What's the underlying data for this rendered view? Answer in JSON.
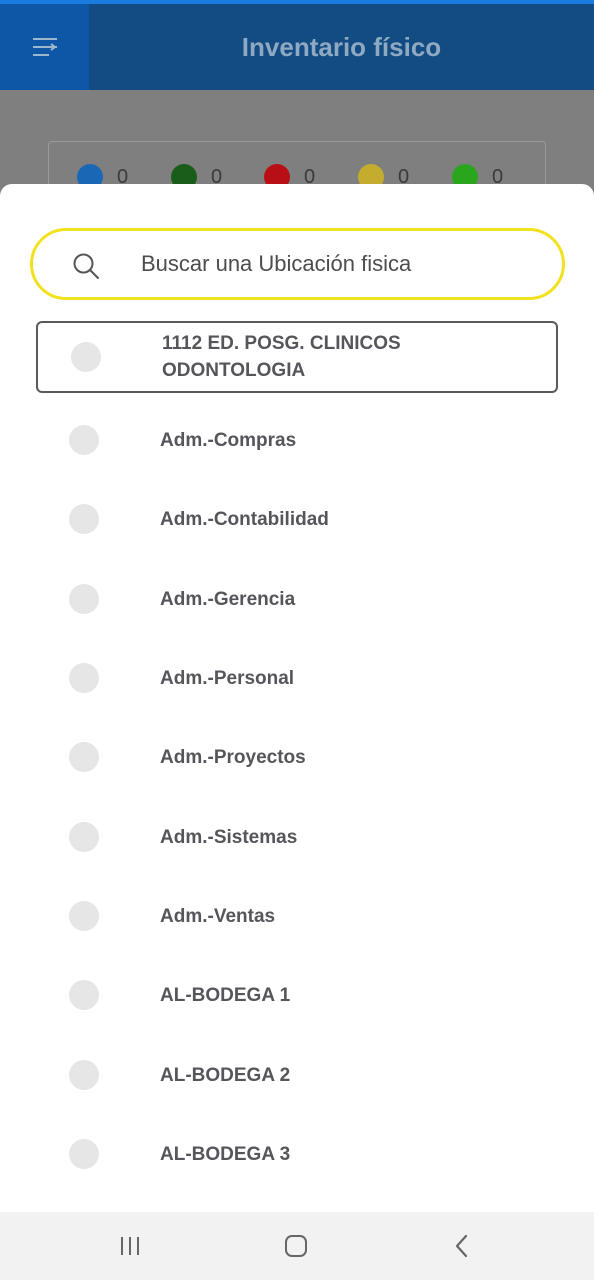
{
  "header": {
    "title": "Inventario físico",
    "menu_icon": "menu-lines-icon"
  },
  "counters": [
    {
      "color": "#1a67b5",
      "value": "0"
    },
    {
      "color": "#1a5c1a",
      "value": "0"
    },
    {
      "color": "#b80f16",
      "value": "0"
    },
    {
      "color": "#c4ac2f",
      "value": "0"
    },
    {
      "color": "#2aa61d",
      "value": "0"
    }
  ],
  "search": {
    "placeholder": "Buscar una Ubicación fisica",
    "value": "",
    "icon": "search-icon",
    "accent": "#f2e11f"
  },
  "locations": [
    {
      "label": "1112 ED. POSG. CLINICOS ODONTOLOGIA",
      "selected": true
    },
    {
      "label": "Adm.-Compras"
    },
    {
      "label": "Adm.-Contabilidad"
    },
    {
      "label": "Adm.-Gerencia"
    },
    {
      "label": "Adm.-Personal"
    },
    {
      "label": "Adm.-Proyectos"
    },
    {
      "label": "Adm.-Sistemas"
    },
    {
      "label": "Adm.-Ventas"
    },
    {
      "label": "AL-BODEGA 1"
    },
    {
      "label": "AL-BODEGA 2"
    },
    {
      "label": "AL-BODEGA 3"
    }
  ],
  "system_nav": {
    "recents_icon": "recents-icon",
    "home_icon": "home-icon",
    "back_icon": "back-icon"
  }
}
